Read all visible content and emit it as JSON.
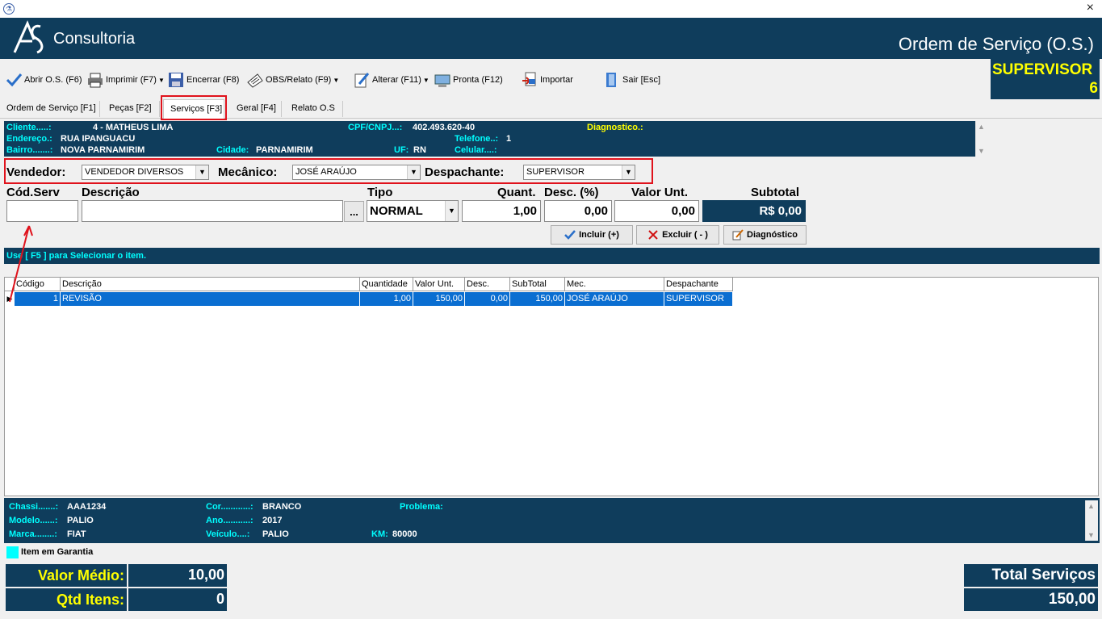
{
  "window": {
    "close_glyph": "×"
  },
  "header": {
    "brand": "Consultoria",
    "title": "Ordem de Serviço (O.S.)"
  },
  "toolbar": {
    "abrir": "Abrir O.S. (F6)",
    "imprimir": "Imprimir  (F7)",
    "encerrar": "Encerrar (F8)",
    "obs": "OBS/Relato (F9)",
    "alterar": "Alterar (F11)",
    "pronta": "Pronta (F12)",
    "importar": "Importar",
    "sair": "Sair [Esc]"
  },
  "user": {
    "name": "SUPERVISOR",
    "number": "6"
  },
  "tabs": [
    "Ordem de Serviço [F1]",
    "Peças [F2]",
    "Serviços [F3]",
    "Geral [F4]",
    "Relato O.S"
  ],
  "cliente": {
    "cliente_label": "Cliente.....:",
    "cliente_value": "4 - MATHEUS LIMA",
    "endereco_label": "Endereço.:",
    "endereco_value": "RUA IPANGUACU",
    "bairro_label": "Bairro.......:",
    "bairro_value": "NOVA PARNAMIRIM",
    "cidade_label": "Cidade:",
    "cidade_value": "PARNAMIRIM",
    "cpf_label": "CPF/CNPJ...:",
    "cpf_value": "402.493.620-40",
    "telefone_label": "Telefone..:",
    "telefone_value": "1",
    "uf_label": "UF:",
    "uf_value": "RN",
    "celular_label": "Celular....:",
    "celular_value": "",
    "diagnostico_label": "Diagnostico.:"
  },
  "equipe": {
    "vendedor_label": "Vendedor:",
    "vendedor_value": "VENDEDOR DIVERSOS",
    "mecanico_label": "Mecânico:",
    "mecanico_value": "JOSÉ ARAÚJO",
    "despachante_label": "Despachante:",
    "despachante_value": "SUPERVISOR"
  },
  "entry": {
    "cod_label": "Cód.Serv",
    "desc_label": "Descrição",
    "tipo_label": "Tipo",
    "quant_label": "Quant.",
    "descp_label": "Desc. (%)",
    "valor_label": "Valor Unt.",
    "subtotal_label": "Subtotal",
    "cod_value": "",
    "desc_value": "",
    "ellipsis": "...",
    "tipo_value": "NORMAL",
    "quant_value": "1,00",
    "descp_value": "0,00",
    "valor_value": "0,00",
    "subtotal_value": "R$ 0,00",
    "incluir": "Incluir (+)",
    "excluir": "Excluir ( - )",
    "diagnostico": "Diagnóstico"
  },
  "hint": "Use [ F5 ] para Selecionar o item.",
  "grid": {
    "columns": [
      "Código",
      "Descrição",
      "Quantidade",
      "Valor Unt.",
      "Desc.",
      "SubTotal",
      "Mec.",
      "Despachante"
    ],
    "rows": [
      [
        "1",
        "REVISÃO",
        "1,00",
        "150,00",
        "0,00",
        "150,00",
        "JOSÉ ARAÚJO",
        "SUPERVISOR"
      ]
    ]
  },
  "veiculo": {
    "chassi_label": "Chassi.......:",
    "chassi_value": "AAA1234",
    "modelo_label": "Modelo......:",
    "modelo_value": "PALIO",
    "marca_label": "Marca........:",
    "marca_value": "FIAT",
    "cor_label": "Cor............:",
    "cor_value": "BRANCO",
    "ano_label": "Ano...........:",
    "ano_value": "2017",
    "veiculo_label": "Veículo....:",
    "veiculo_value": "PALIO",
    "km_label": "KM:",
    "km_value": "80000",
    "problema_label": "Problema:"
  },
  "legend": "Item em Garantia",
  "summary": {
    "valor_medio_label": "Valor Médio:",
    "valor_medio_value": "10,00",
    "qtd_itens_label": "Qtd Itens:",
    "qtd_itens_value": "0",
    "total_label": "Total Serviços",
    "total_value": "150,00"
  },
  "colors": {
    "header": "#0f3d5c",
    "accent_yellow": "#ffff00",
    "accent_cyan": "#00ffff",
    "highlight": "#e0121c",
    "row_selected": "#0a6ed1"
  }
}
